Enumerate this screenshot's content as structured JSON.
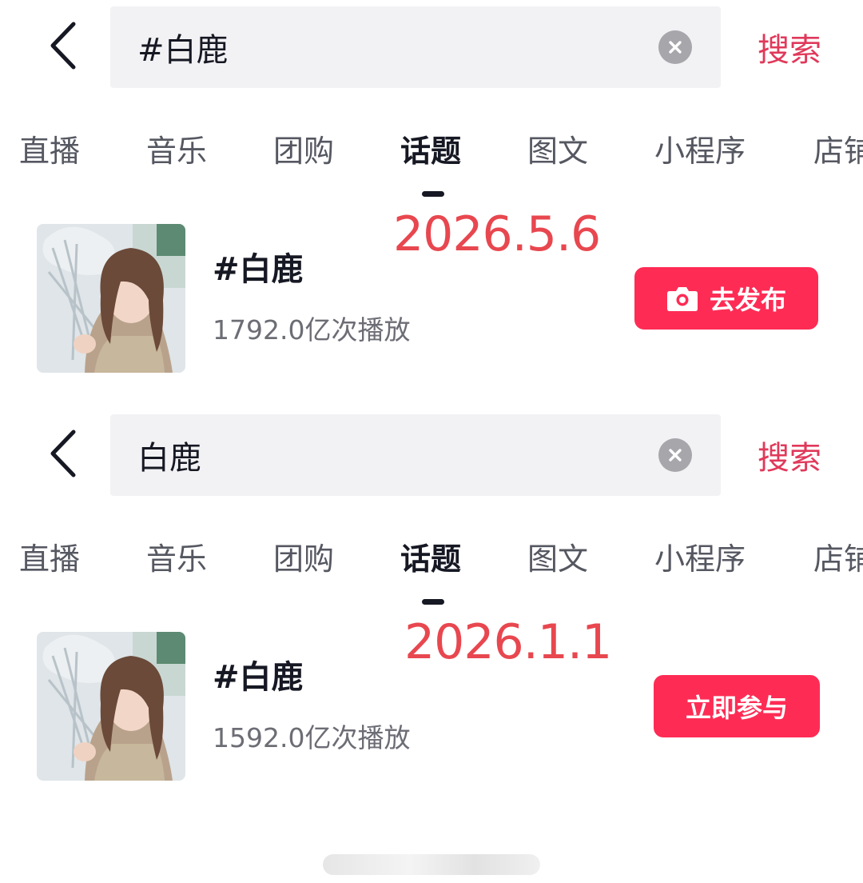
{
  "colors": {
    "accent": "#fe2c55",
    "search_link": "#e0395a",
    "date_overlay": "#e8474f",
    "search_bg": "#f2f2f4"
  },
  "panels": [
    {
      "search": {
        "query": "#白鹿",
        "button_label": "搜索"
      },
      "tabs": [
        "直播",
        "音乐",
        "团购",
        "话题",
        "图文",
        "小程序",
        "店铺"
      ],
      "active_tab": "话题",
      "result": {
        "title": "#白鹿",
        "play_count": "1792.0亿次播放",
        "date_overlay": "2026.5.6",
        "action_label": "去发布",
        "action_icon": "camera-icon"
      }
    },
    {
      "search": {
        "query": "白鹿",
        "button_label": "搜索"
      },
      "tabs": [
        "直播",
        "音乐",
        "团购",
        "话题",
        "图文",
        "小程序",
        "店铺"
      ],
      "active_tab": "话题",
      "result": {
        "title": "#白鹿",
        "play_count": "1592.0亿次播放",
        "date_overlay": "2026.1.1",
        "action_label": "立即参与"
      }
    }
  ]
}
